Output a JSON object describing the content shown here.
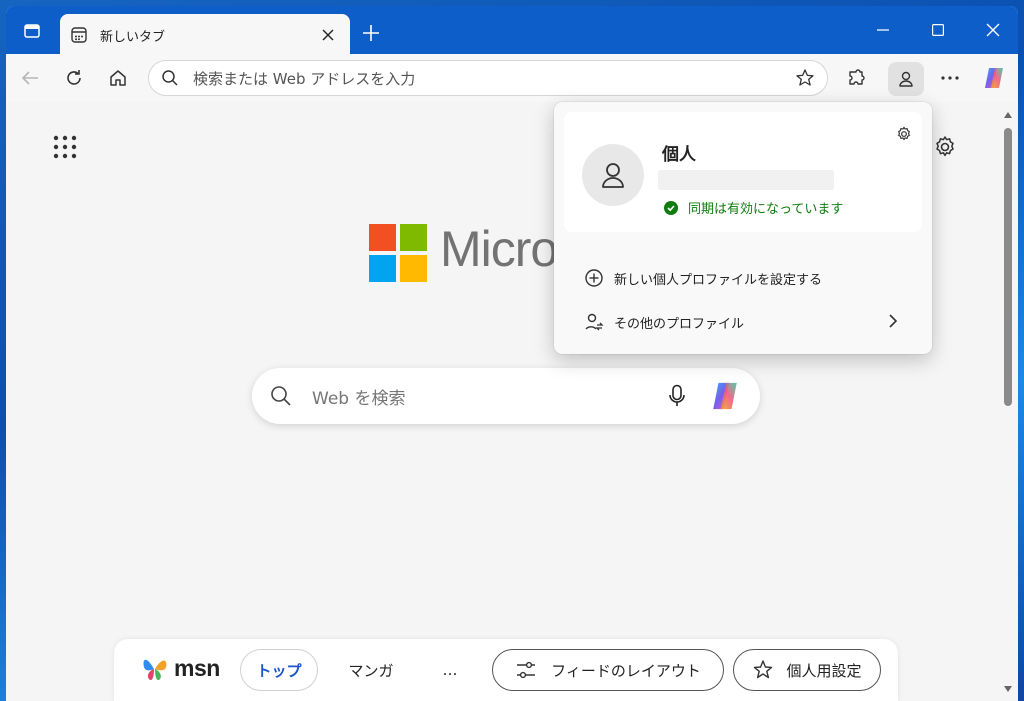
{
  "browser": {
    "tab": {
      "title": "新しいタブ"
    },
    "address": {
      "placeholder": "検索または Web アドレスを入力"
    }
  },
  "icons": [
    "sidebar-toggle-icon",
    "new-tab-page-icon",
    "close-icon",
    "plus-icon",
    "minimize-icon",
    "maximize-icon",
    "window-close-icon",
    "back-arrow-icon",
    "refresh-icon",
    "home-icon",
    "search-icon",
    "star-icon",
    "extensions-icon",
    "profile-icon",
    "more-icon",
    "copilot-icon",
    "apps-grid-icon",
    "gear-icon",
    "microphone-icon",
    "sliders-icon",
    "sparkle-star-icon",
    "chevron-right-icon"
  ],
  "page": {
    "logo_text": "Microsoft",
    "search": {
      "placeholder": "Web を検索"
    }
  },
  "msn": {
    "logo_text": "msn",
    "tabs": [
      {
        "label": "トップ",
        "active": true
      },
      {
        "label": "マンガ",
        "active": false
      },
      {
        "label": "…",
        "active": false
      }
    ],
    "feed_layout_label": "フィードのレイアウト",
    "personalize_label": "個人用設定"
  },
  "profile_flyout": {
    "name": "個人",
    "sync_status": "同期は有効になっています",
    "menu": [
      {
        "label": "新しい個人プロファイルを設定する"
      },
      {
        "label": "その他のプロファイル"
      }
    ]
  },
  "colors": {
    "titlebar": "#0e5ec9",
    "sync_green": "#107c10",
    "active_tab_blue": "#1a56c4",
    "ms_red": "#f25022",
    "ms_green": "#7fba00",
    "ms_blue": "#00a4ef",
    "ms_yellow": "#ffb900"
  }
}
